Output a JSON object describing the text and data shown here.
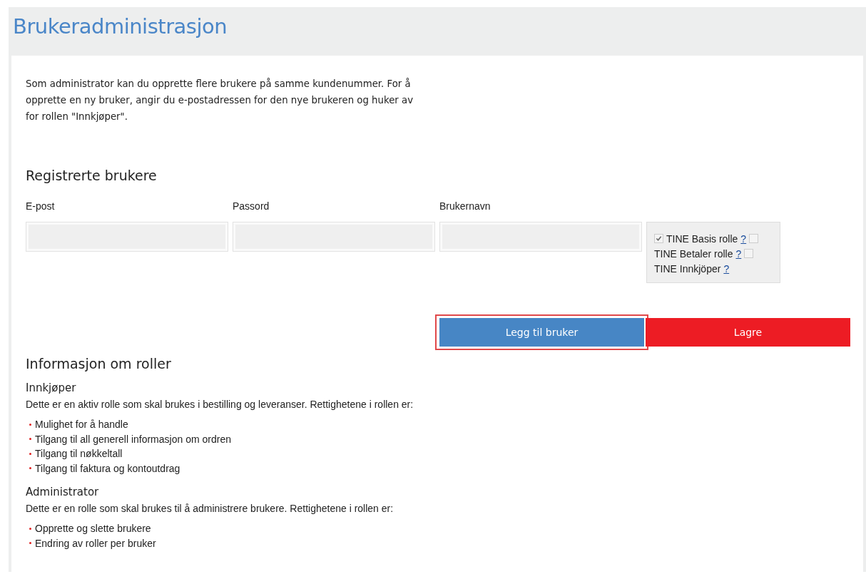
{
  "title": "Brukeradministrasjon",
  "intro": "Som administrator kan du opprette flere brukere på samme kundenummer. For å opprette en ny bruker, angir du e-postadressen for den nye brukeren og huker av for rollen \"Innkjøper\".",
  "users": {
    "heading": "Registrerte brukere",
    "fields": [
      {
        "label": "E-post"
      },
      {
        "label": "Passord"
      },
      {
        "label": "Brukernavn"
      }
    ],
    "roles": [
      {
        "label": "TINE Basis rolle",
        "help": "?",
        "lead_checked": true,
        "trail_checked": false
      },
      {
        "label": "TINE Betaler rolle",
        "help": "?",
        "trail_checked": false
      },
      {
        "label": "TINE Innkjöper",
        "help": "?"
      }
    ]
  },
  "buttons": [
    {
      "label": "Legg til bruker",
      "kind": "primary",
      "highlighted": true
    },
    {
      "label": "Lagre",
      "kind": "danger",
      "highlighted": false
    }
  ],
  "info": {
    "heading": "Informasjon om roller",
    "sections": [
      {
        "title": "Innkjøper",
        "text": "Dette er en aktiv rolle som skal brukes i bestilling og leveranser. Rettighetene i rollen er:",
        "items": [
          "Mulighet for å handle",
          "Tilgang til all generell informasjon om ordren",
          "Tilgang til nøkkeltall",
          "Tilgang til faktura og kontoutdrag"
        ]
      },
      {
        "title": "Administrator",
        "text": "Dette er en rolle som skal brukes til å administrere brukere. Rettighetene i rollen er:",
        "items": [
          "Opprette og slette brukere",
          "Endring av roller per bruker"
        ]
      }
    ]
  }
}
